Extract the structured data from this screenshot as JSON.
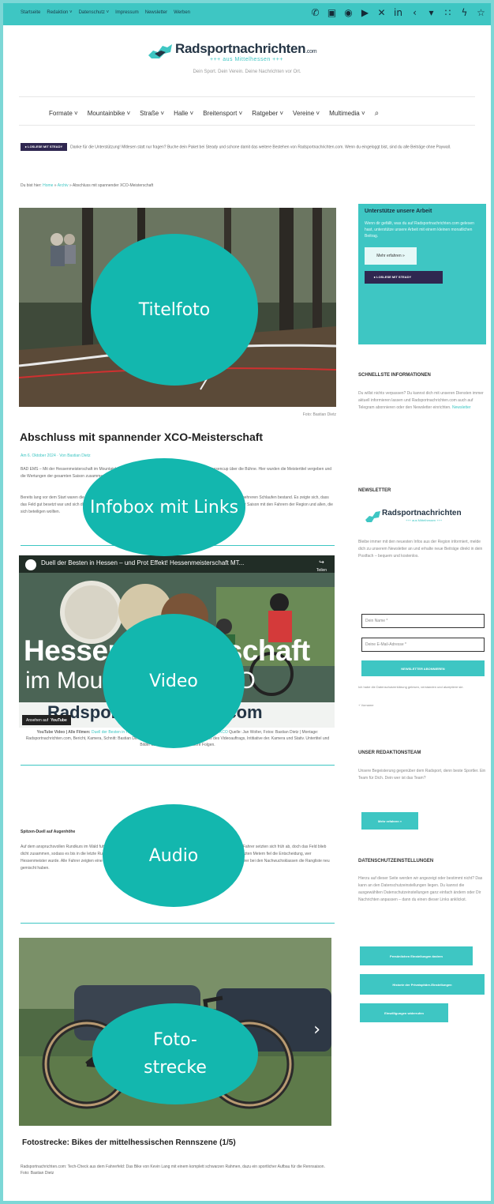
{
  "topbar": {
    "nav": [
      "Startseite",
      "Redaktion ˅",
      "Datenschutz ˅",
      "Impressum",
      "Newsletter",
      "Werben"
    ],
    "social": [
      "whatsapp-icon",
      "page-icon",
      "threads-icon",
      "youtube-icon",
      "x-icon",
      "linkedin-icon",
      "share-icon",
      "location-icon",
      "rss-icon",
      "bolt-icon",
      "star-icon"
    ]
  },
  "logo": {
    "title": "Radsportnachrichten",
    ".com": ".com",
    "title_suffix": ".com",
    "subtitle": "+++ aus Mittelhessen +++",
    "tagline": "Dein Sport. Dein Verein. Deine Nachrichten vor Ort."
  },
  "mainnav": [
    "Formate ˅",
    "Mountainbike ˅",
    "Straße ˅",
    "Halle ˅",
    "Breitensport ˅",
    "Ratgeber ˅",
    "Vereine ˅",
    "Multimedia ˅"
  ],
  "steady_label": "▸ LOSLESE MIT STEADY",
  "notice": "Danke für die Unterstützung! Mitlesen statt nur fragen? Buche dein Paket bei Steady und schone damit das weitere Bestehen von Radsportnachrichten.com. Wenn du eingeloggt bist, sind du alle Beiträge ohne Paywall.",
  "breadcrumb": {
    "prefix": "Du bist hier:",
    "home": "Home",
    "section": "Archiv",
    "current": "Abschluss mit spannender XCO-Meisterschaft"
  },
  "hero": {
    "caption": "Foto: Bastian Dietz"
  },
  "article": {
    "title": "Abschluss mit spannender XCO-Meisterschaft",
    "meta": "Am 6. Oktober 2024 · Von Bastian Dietz",
    "p1": "BAD EMS – Mit der Hessenmeisterschaft im Mountainbike XCO ging die Saison 2024 zum Finale des MTB-Hessencup über die Bühne. Hier wurden die Meistertitel vergeben und die Wertungen der gesamten Saison zusammengeführt und ausgezeichnet.",
    "p2": "Bereits lang vor dem Start waren die ersten Fahrer auf der Strecke, um sich mit dem Kurs vertraut zu machen, der jedoch aus mehreren Schlaufen bestand. Es zeigte sich, dass das Feld gut besetzt war und sich die Favoriten absetzen konnten. Weiter geht es bei der Hessenmeisterschaft bis zum Ende der Saison mit den Fahrern der Region und allen, die sich beteiligen wollten.",
    "video_caption_lead": "YouTube Video | Alle Filmen:",
    "video_caption_link": "Duell der Besten in Hessen – und Prot Effekt! Hessenmeisterschaft MTB XCO",
    "video_caption_rest": "Quelle: Jan Wolter, Fotos: Bastian Dietz | Montage: Radsportnachrichten.com, Bericht, Kamera, Schnitt: Bastian Dietz. Tonr Dort die Sprungmeister der Tracks des Videoauftrags, Intitiative der. Kamera und Stativ. Untertitel und Bilder aus dem Dreh sowie weitere Folgen.",
    "subhead": "Spitzen-Duell auf Augenhöhe",
    "p3": "Auf dem anspruchsvollen Rundkurs im Wald fuhren die Fahrer über Wurzeln, Steine und technische Abfahrten. Die schnellsten Fahrer setzten sich früh ab, doch das Feld blieb dicht zusammen, sodass es bis in die letzte Runde spannend blieb. Am Ende entschied die bessere Kraftreserve und auf den letzten Metern fiel die Entscheidung, wer Hessenmeister wurde. Alle Fahrer zeigten eine starke Leistung auf der Strecke und bewiesen Ausdauer, wobei die jüngeren Fahrer bei den Nachwuchsklassen die Rangliste neu gemischt haben."
  },
  "video": {
    "title": "Duell der Besten in Hessen – und Prot Effekt! Hessenmeisterschaft MT...",
    "overlay_big": "Hessenmeisterschaft",
    "overlay_small": "im Mountainbike XCO",
    "logo": "Radsportnachrichten.com",
    "share": "Teilen",
    "watch_label": "Ansehen auf",
    "youtube": "YouTube"
  },
  "gallery": {
    "title": "Fotostrecke: Bikes der mittelhessischen Rennszene (1/5)",
    "caption": "Radsportnachrichten.com: Tech-Check aus dem Fahrerfeld: Das Bike von Kevin Lang mit einem komplett schwarzen Rahmen, dazu ein sportlicher Aufbau für die Rennsaison. Foto: Bastian Dietz"
  },
  "overlays": [
    "Titelfoto",
    "Infobox mit Links",
    "Video",
    "Audio",
    "Foto-strecke"
  ],
  "sidebar": {
    "support_title": "Unterstütze unsere Arbeit",
    "support_text": "Wenn dir gefällt, was du auf Radsportnachrichten.com gelesen hast, unterstütze unsere Arbeit mit einem kleinen monatlichen Beitrag.",
    "support_btn": "Mehr erfahren »",
    "fast_title": "SCHNELLSTE INFORMATIONEN",
    "fast_text": "Du willst nichts verpassen? Du kannst dich mit unseren Diensten immer aktuell informieren lassen und Radsportnachrichten.com auch auf Telegram abonnieren oder den Newsletter einrichten.",
    "fast_link": "Newsletter",
    "newsletter_title": "NEWSLETTER",
    "nl_logo": "Radsportnachrichten",
    "nl_sub": "+++ aus Mittelhessen +++",
    "nl_text": "Bleibe immer mit den neuesten Infos aus der Region informiert, melde dich zu unserem Newsletter an und erhalte neue Beiträge direkt in dein Postfach – bequem und kostenlos.",
    "field_name": "Dein Name *",
    "field_email": "Deine E-Mail-Adresse *",
    "nl_button": "NEWSLETTER ABONNIEREN",
    "privacy_text": "Ich habe die Datenschutzerklärung gelesen, verstanden und akzeptiere sie.",
    "privacy_link": "Datenschutzerklärung",
    "optional": "+ Vorname",
    "team_title": "UNSER REDAKTIONSTEAM",
    "team_text": "Unsere Begeisterung gegenüber dem Radsport, denn beste Sportler. Ein Team für Dich. Dein wer ist das Team?",
    "team_btn": "Mehr erfahren »",
    "privacy_title": "DATENSCHUTZEINSTELLUNGEN",
    "privacy_box_text": "Hierzu auf dieser Seite werden wir angezeigt oder bestimmt nicht? Das kann an den Datenschutzeinstellungen liegen. Du kannst die ausgewählten Datenschutzeinstellungen ganz einfach ändern oder Dir Nachrichten anpassen – dann du einen dieser Links anklickst.",
    "btn1": "Persönlichen Einstellungen ändern",
    "btn2": "Historie der Privatsphäre-Einstellungen",
    "btn3": "Einwilligungen widerrufen"
  }
}
